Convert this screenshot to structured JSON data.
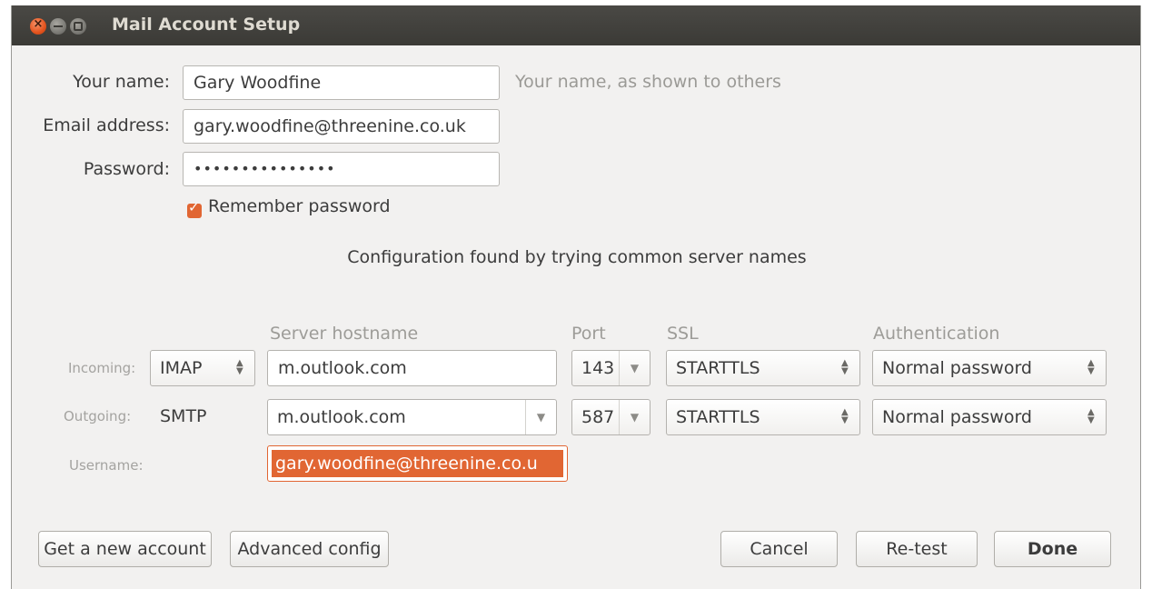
{
  "window": {
    "title": "Mail Account Setup",
    "close_glyph": "×"
  },
  "identity": {
    "name_label": "Your name:",
    "name_value": "Gary Woodfine",
    "name_hint": "Your name, as shown to others",
    "email_label": "Email address:",
    "email_value": "gary.woodfine@threenine.co.uk",
    "password_label": "Password:",
    "password_value": "•••••••••••••••",
    "remember_label": "Remember password",
    "remember_checked": true
  },
  "status": "Configuration found by trying common server names",
  "columns": {
    "hostname": "Server hostname",
    "port": "Port",
    "ssl": "SSL",
    "auth": "Authentication"
  },
  "incoming": {
    "label": "Incoming:",
    "protocol": "IMAP",
    "hostname": "m.outlook.com",
    "port": "143",
    "ssl": "STARTTLS",
    "auth": "Normal password"
  },
  "outgoing": {
    "label": "Outgoing:",
    "protocol": "SMTP",
    "hostname": "m.outlook.com",
    "port": "587",
    "ssl": "STARTTLS",
    "auth": "Normal password"
  },
  "username": {
    "label": "Username:",
    "value": "gary.woodfine@threenine.co.u"
  },
  "buttons": {
    "new_account": "Get a new account",
    "advanced": "Advanced config",
    "cancel": "Cancel",
    "retest": "Re-test",
    "done": "Done"
  },
  "colors": {
    "accent": "#e16633",
    "titlebar": "#3c3b37"
  }
}
